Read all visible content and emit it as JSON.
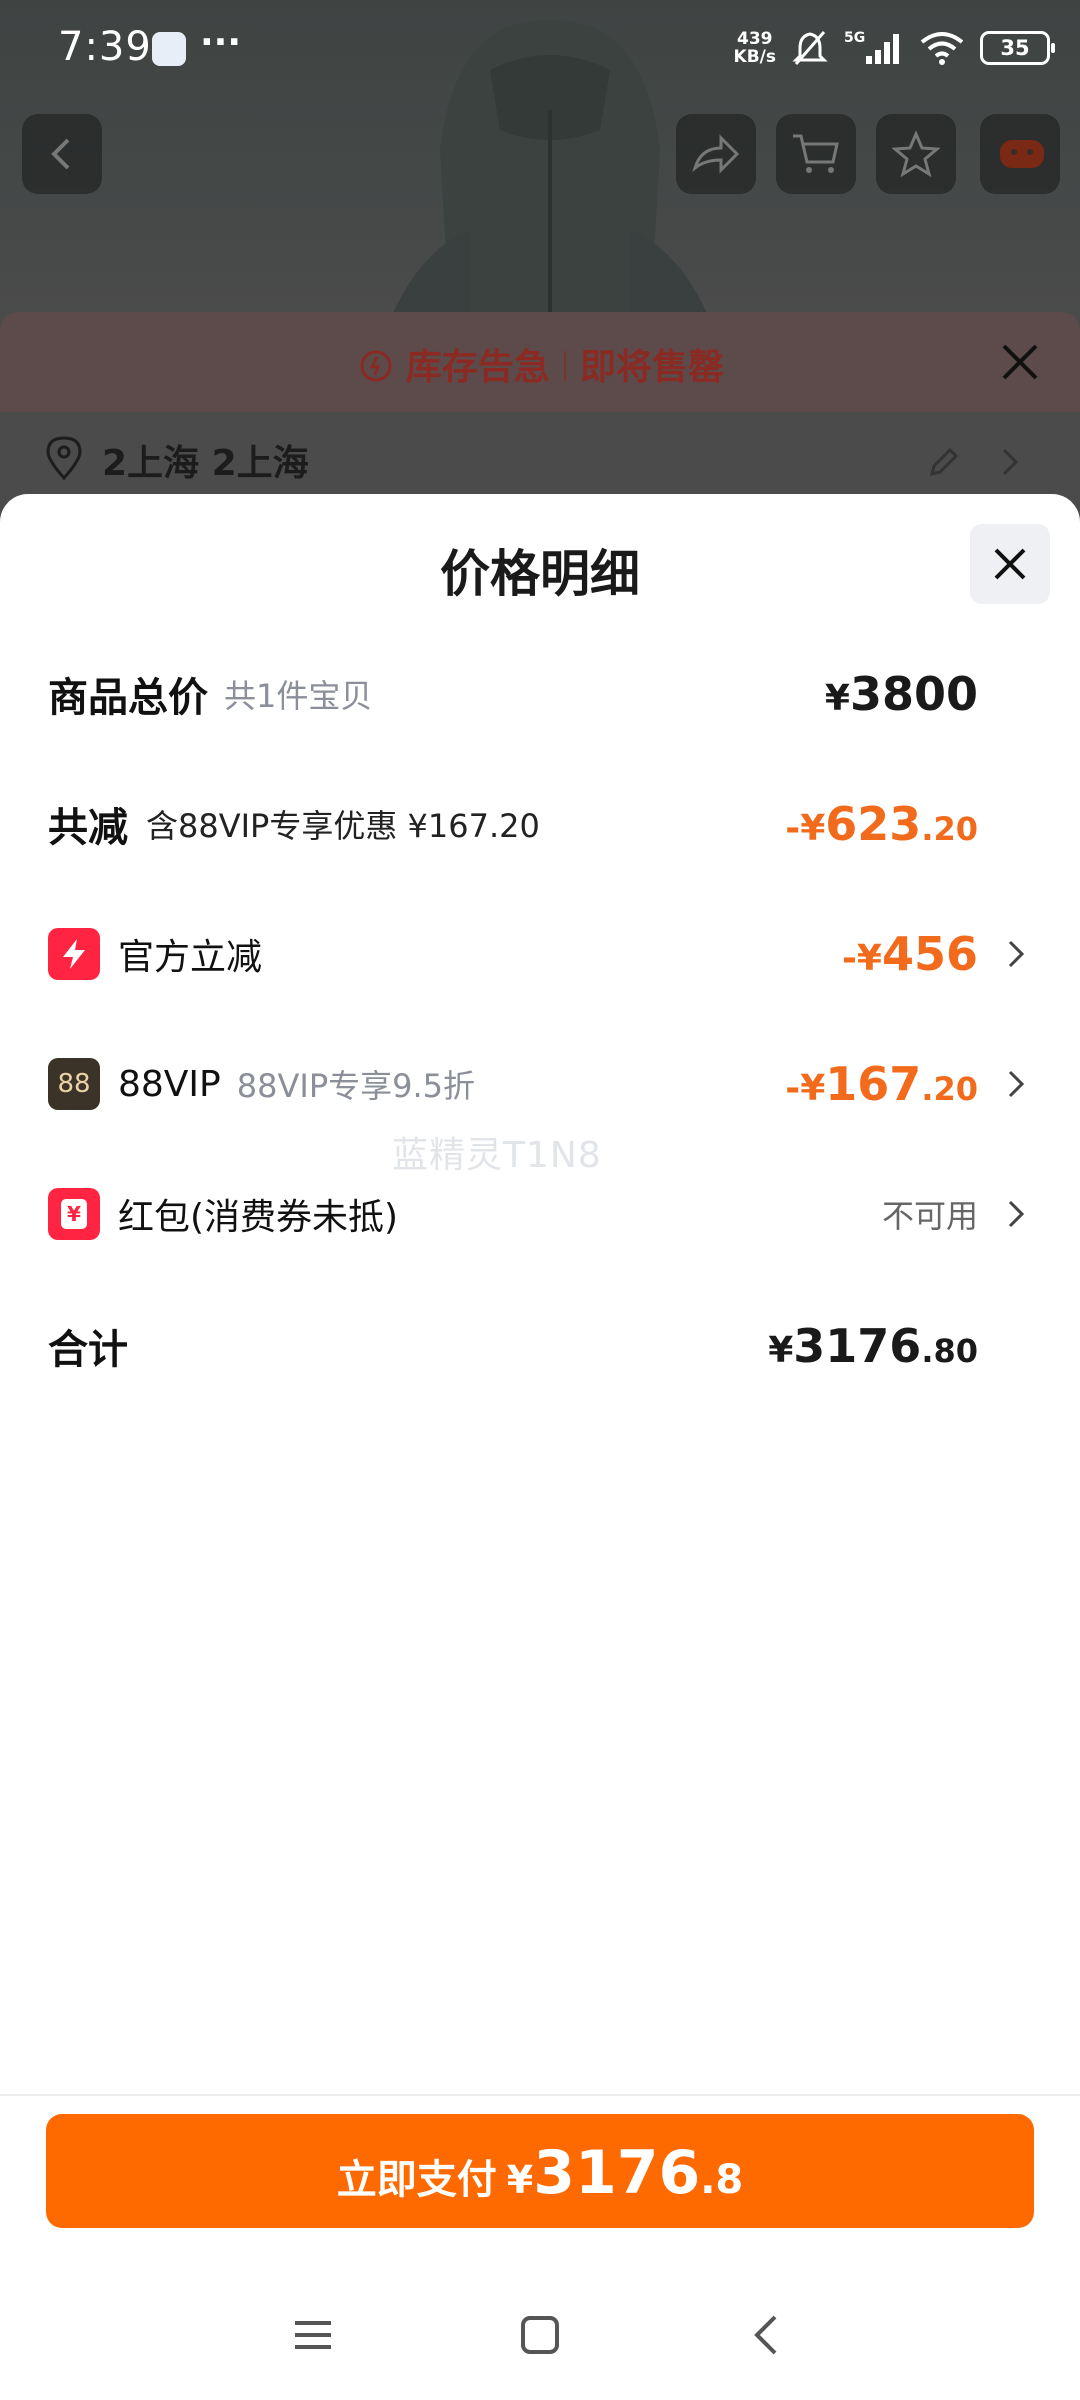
{
  "status_bar": {
    "time": "7:39",
    "more": "···",
    "net_speed_value": "439",
    "net_speed_unit": "KB/s",
    "battery": "35"
  },
  "stock_banner": {
    "text": "库存告急",
    "separator": "|",
    "text2": "即将售罄"
  },
  "address": {
    "text": "2上海 2上海"
  },
  "sheet": {
    "title": "价格明细",
    "rows": [
      {
        "label": "商品总价",
        "sub": "共1件宝贝",
        "symbol": "¥",
        "value": "3800",
        "decimal": ""
      },
      {
        "label": "共减",
        "sub": "含88VIP专享优惠 ¥167.20",
        "symbol": "-¥",
        "value": "623",
        "decimal": ".20"
      },
      {
        "label": "官方立减",
        "symbol": "-¥",
        "value": "456",
        "decimal": ""
      },
      {
        "label": "88VIP",
        "badge": "88",
        "sub": "88VIP专享9.5折",
        "symbol": "-¥",
        "value": "167",
        "decimal": ".20"
      },
      {
        "label": "红包(消费券未抵)",
        "badge": "¥",
        "value": "不可用"
      },
      {
        "label": "合计",
        "symbol": "¥",
        "value": "3176",
        "decimal": ".80"
      }
    ]
  },
  "watermark": "蓝精灵T1N8",
  "pay_button": {
    "label": "立即支付",
    "symbol": "¥",
    "value": "3176",
    "decimal": ".8"
  },
  "colors": {
    "accent": "#ff6a00",
    "discount": "#f26b1d",
    "badge_red": "#ff2442"
  }
}
